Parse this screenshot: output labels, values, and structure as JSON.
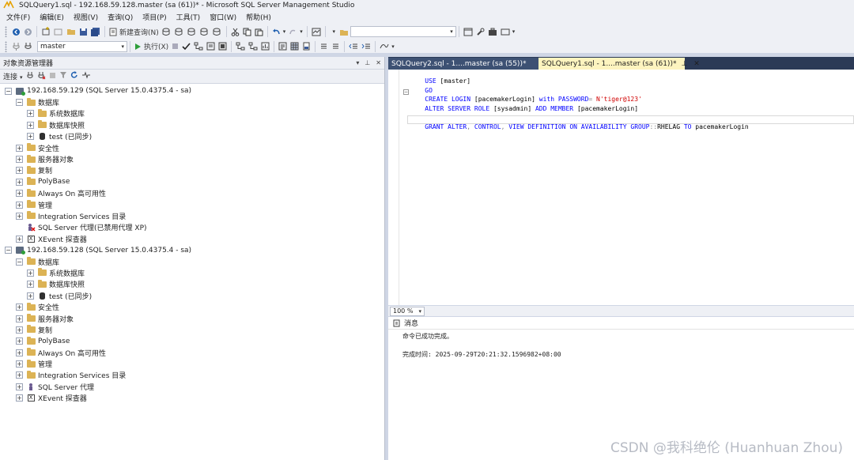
{
  "window": {
    "title": "SQLQuery1.sql - 192.168.59.128.master (sa (61))* - Microsoft SQL Server Management Studio"
  },
  "menu": [
    "文件(F)",
    "编辑(E)",
    "视图(V)",
    "查询(Q)",
    "项目(P)",
    "工具(T)",
    "窗口(W)",
    "帮助(H)"
  ],
  "toolbar": {
    "new_query_label": "新建查询(N)",
    "search_value": ""
  },
  "toolbar2": {
    "database_value": "master",
    "execute_label": "执行(X)"
  },
  "object_explorer": {
    "title": "对象资源管理器",
    "connect_label": "连接",
    "servers": [
      {
        "name": "192.168.59.129 (SQL Server 15.0.4375.4 - sa)",
        "databases_label": "数据库",
        "children": [
          "系统数据库",
          "数据库快照",
          "test (已同步)"
        ],
        "items": [
          "安全性",
          "服务器对象",
          "复制",
          "PolyBase",
          "Always On 高可用性",
          "管理",
          "Integration Services 目录"
        ],
        "agent_label": "SQL Server 代理(已禁用代理 XP)",
        "xevent_label": "XEvent 探查器"
      },
      {
        "name": "192.168.59.128 (SQL Server 15.0.4375.4 - sa)",
        "databases_label": "数据库",
        "children": [
          "系统数据库",
          "数据库快照",
          "test (已同步)"
        ],
        "items": [
          "安全性",
          "服务器对象",
          "复制",
          "PolyBase",
          "Always On 高可用性",
          "管理",
          "Integration Services 目录"
        ],
        "agent_label": "SQL Server 代理",
        "xevent_label": "XEvent 探查器"
      }
    ]
  },
  "tabs": [
    {
      "label": "SQLQuery2.sql - 1....master (sa (55))*"
    },
    {
      "label": "SQLQuery1.sql - 1....master (sa (61))*"
    }
  ],
  "editor": {
    "line1_kw": "USE",
    "line1_rest": " [master]",
    "line2_kw": "GO",
    "line3_kw1": "CREATE LOGIN",
    "line3_id": " [pacemakerLogin] ",
    "line3_kw2": "with PASSWORD",
    "line3_op": "=",
    "line3_str": " N'tiger@123'",
    "line4_kw1": "ALTER SERVER ROLE",
    "line4_id1": " [sysadmin] ",
    "line4_kw2": "ADD MEMBER",
    "line4_id2": " [pacemakerLogin]",
    "line5_kw1": "GRANT ALTER",
    "line5_op1": ",",
    "line5_kw2": " CONTROL",
    "line5_op2": ",",
    "line5_kw3": " VIEW DEFINITION ON AVAILABILITY GROUP",
    "line5_op3": "::",
    "line5_id": "RHELAG ",
    "line5_kw4": "TO",
    "line5_id2": " pacemakerLogin"
  },
  "zoom": "100 %",
  "results": {
    "tab_label": "消息",
    "message": "命令已成功完成。",
    "completion_label": "完成时间: ",
    "completion_time": "2025-09-29T20:21:32.1596982+08:00"
  },
  "watermark": "CSDN @我科绝伦 (Huanhuan Zhou)"
}
